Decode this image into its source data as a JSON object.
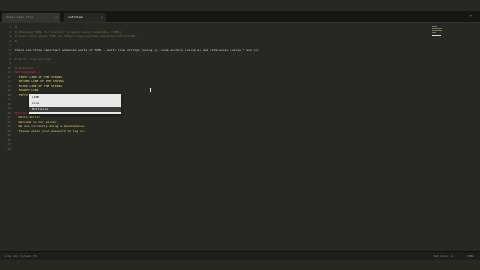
{
  "tabs": [
    {
      "label": "hosts_test_file",
      "active": false
    },
    {
      "label": "untitled",
      "active": true
    }
  ],
  "gutter": {
    "line_numbers": [
      "1",
      "2",
      "3",
      "4",
      "5",
      "6",
      "7",
      "8",
      "9",
      "10",
      "11",
      "12",
      "13",
      "14",
      "15",
      "16",
      "17",
      "18",
      "19",
      "20",
      "21",
      "22",
      "23",
      "24",
      "25",
      "26",
      "27",
      "28"
    ]
  },
  "code": {
    "lines": [
      {
        "text": "#",
        "class": "c-comment"
      },
      {
        "text": "# Advanced YAML for Ansible: plugins using templates (YAML)",
        "class": "c-comment"
      },
      {
        "text": "# Learn more about YAML at https://www.youtube.com/playlist?list=PL...",
        "class": "c-comment"
      },
      {
        "text": "#",
        "class": "c-comment"
      },
      {
        "text": "",
        "class": "c-text"
      },
      {
        "text": "There are three important advanced parts of YAML - multi line strings (using |), node anchors (using &) and references (using * and <<)",
        "class": "c-text"
      },
      {
        "text": "",
        "class": "c-text"
      },
      {
        "text": "# multi line strings",
        "class": "c-comment"
      },
      {
        "text": "",
        "class": "c-text"
      },
      {
        "text": "# Examples",
        "class": "c-comment"
      },
      {
        "text": "StringPiped: |",
        "class": "c-key"
      },
      {
        "text": "  FIRST LINE OF THE STRING",
        "class": "c-str"
      },
      {
        "text": "  SECOND LINE OF THE STRING",
        "class": "c-str"
      },
      {
        "text": "  THIRD LINE OF THE STRING",
        "class": "c-str"
      },
      {
        "text": "  FOURTH LINE",
        "class": "c-str"
      },
      {
        "text": "  FIFTH LINE",
        "class": "c-str"
      },
      {
        "text": "",
        "class": "c-text"
      },
      {
        "text": "",
        "class": "c-text"
      },
      {
        "text": "",
        "class": "c-text"
      },
      {
        "text": "MultiLine: >",
        "class": "c-key"
      },
      {
        "text": "  Hello World!",
        "class": "c-str"
      },
      {
        "text": "  Welcome on our server.",
        "class": "c-str"
      },
      {
        "text": "  We are currently doing a maintenance.",
        "class": "c-str"
      },
      {
        "text": "  Please enter your password to log in.",
        "class": "c-str"
      }
    ]
  },
  "autocomplete": {
    "items": [
      {
        "label": "LINE",
        "selected": false
      },
      {
        "label": "Line",
        "selected": false
      },
      {
        "label": "MultiLine",
        "selected": true
      }
    ]
  },
  "status": {
    "left": "Line 14, Column 15",
    "tab_size": "Tab Size: 4",
    "syntax": "YAML"
  },
  "icons": {
    "tab_close": "close-icon",
    "menu": "menu-icon"
  },
  "colors": {
    "background": "#272822",
    "comment": "#75715e",
    "key": "#f92672",
    "string": "#e6db74"
  }
}
